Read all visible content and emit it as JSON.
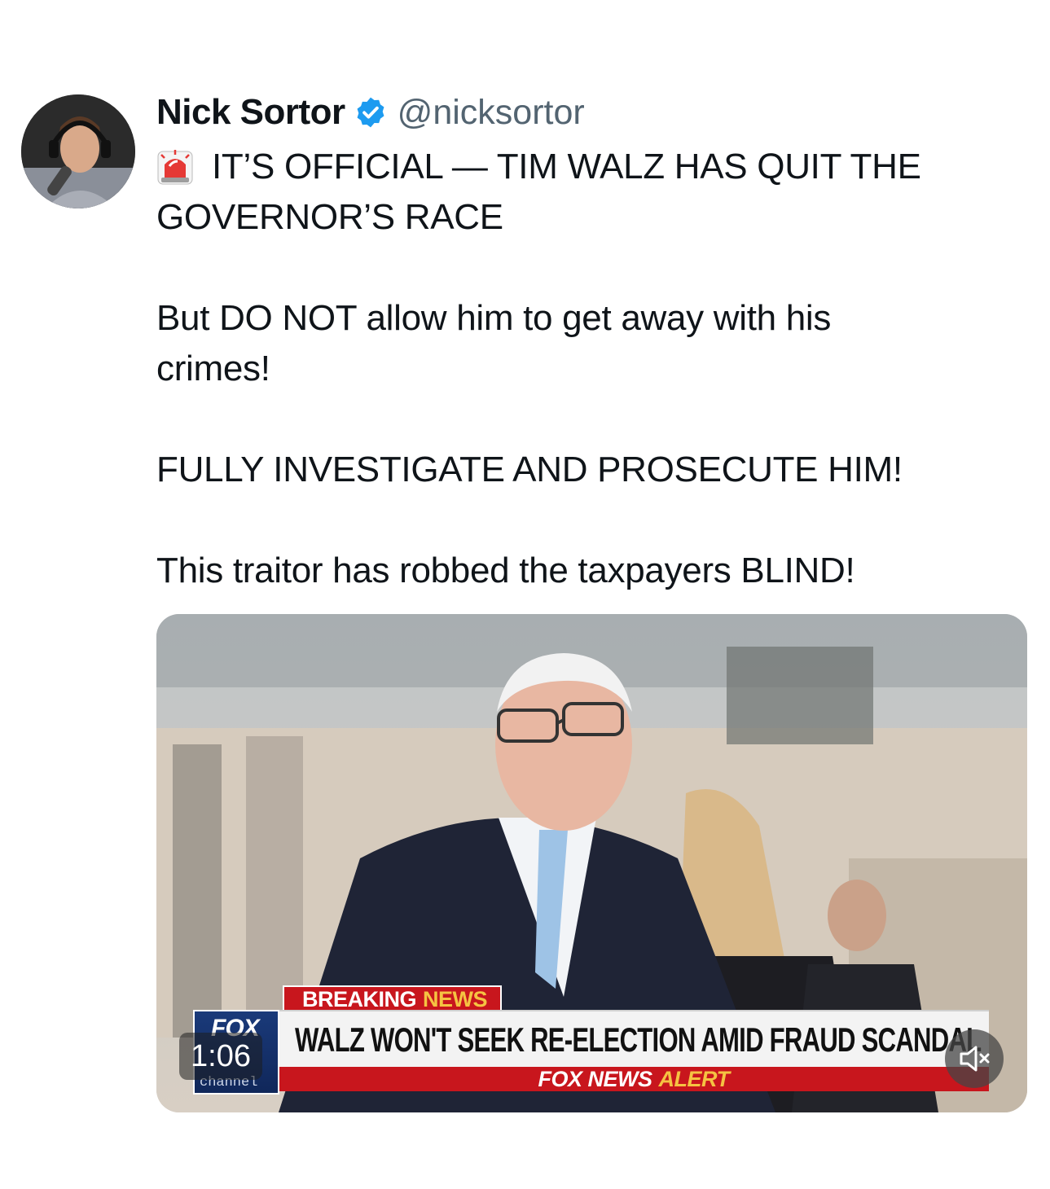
{
  "tweet": {
    "display_name": "Nick Sortor",
    "handle": "@nicksortor",
    "verified_icon": "verified-badge-icon",
    "verified_color": "#1d9bf0",
    "lines": [
      "IT’S OFFICIAL — TIM WALZ HAS QUIT THE",
      "GOVERNOR’S RACE",
      "But DO NOT allow him to get away with his",
      "crimes!",
      "FULLY INVESTIGATE AND PROSECUTE HIM!",
      "This traitor has robbed the taxpayers BLIND!"
    ],
    "lead_icon": "siren-emoji-icon"
  },
  "media": {
    "breaking_word1": "BREAKING",
    "breaking_word2": "NEWS",
    "headline": "WALZ WON'T SEEK RE-ELECTION AMID FRAUD SCANDAL",
    "alert_word1": "FOX NEWS",
    "alert_word2": "ALERT",
    "logo_top": "FOX",
    "logo_bottom": "channel",
    "duration": "1:06",
    "mute_icon": "speaker-muted-icon",
    "ticker_red": "#c8161d",
    "ticker_yellow": "#f5c342"
  }
}
